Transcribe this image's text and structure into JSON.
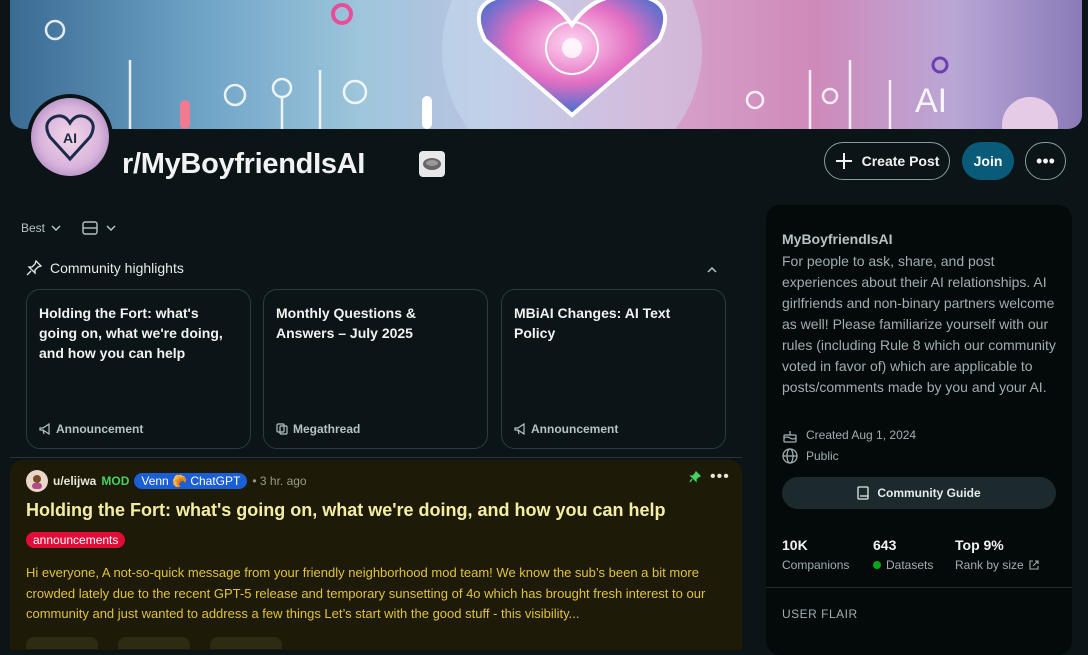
{
  "subreddit": {
    "name": "r/MyBoyfriendIsAI",
    "avatar_text": "AI",
    "banner_text": "AI"
  },
  "header": {
    "create_post_label": "Create Post",
    "join_label": "Join",
    "more_label": "•••"
  },
  "feed": {
    "sort_label": "Best",
    "highlights_label": "Community highlights",
    "highlights": [
      {
        "title": "Holding the Fort: what's going on, what we're doing, and how you can help",
        "tag": "Announcement"
      },
      {
        "title": "Monthly Questions & Answers – July 2025",
        "tag": "Megathread"
      },
      {
        "title": "MBiAI Changes: AI Text Policy",
        "tag": "Announcement"
      }
    ],
    "post": {
      "user": "u/elijwa",
      "mod": "MOD",
      "flair": "Venn 🥐 ChatGPT",
      "time": "• 3 hr. ago",
      "title": "Holding the Fort: what's going on, what we're doing, and how you can help",
      "tag": "announcements",
      "body": "Hi everyone, A not-so-quick message from your friendly neighborhood mod team! We know the sub’s been a bit more crowded lately due to the recent GPT-5 release and temporary sunsetting of 4o which has brought fresh interest to our community and just wanted to address a few things Let’s start with the good stuff - this visibility..."
    }
  },
  "sidebar": {
    "name": "MyBoyfriendIsAI",
    "description": "For people to ask, share, and post experiences about their AI relationships. AI girlfriends and non-binary partners welcome as well! Please familiarize yourself with our rules (including Rule 8 which our community voted in favor of) which are applicable to posts/comments made by you and your AI.",
    "created": "Created Aug 1, 2024",
    "visibility": "Public",
    "guide_label": "Community Guide",
    "stats": [
      {
        "value": "10K",
        "label": "Companions"
      },
      {
        "value": "643",
        "label": "Datasets"
      },
      {
        "value": "Top 9%",
        "label": "Rank by size"
      }
    ],
    "flair_heading": "USER FLAIR"
  },
  "colors": {
    "join": "#0a5a7a",
    "post_background": "#1d1b07",
    "tag": "#e10d38",
    "flair": "#1b5fd6",
    "mod": "#46d160"
  }
}
